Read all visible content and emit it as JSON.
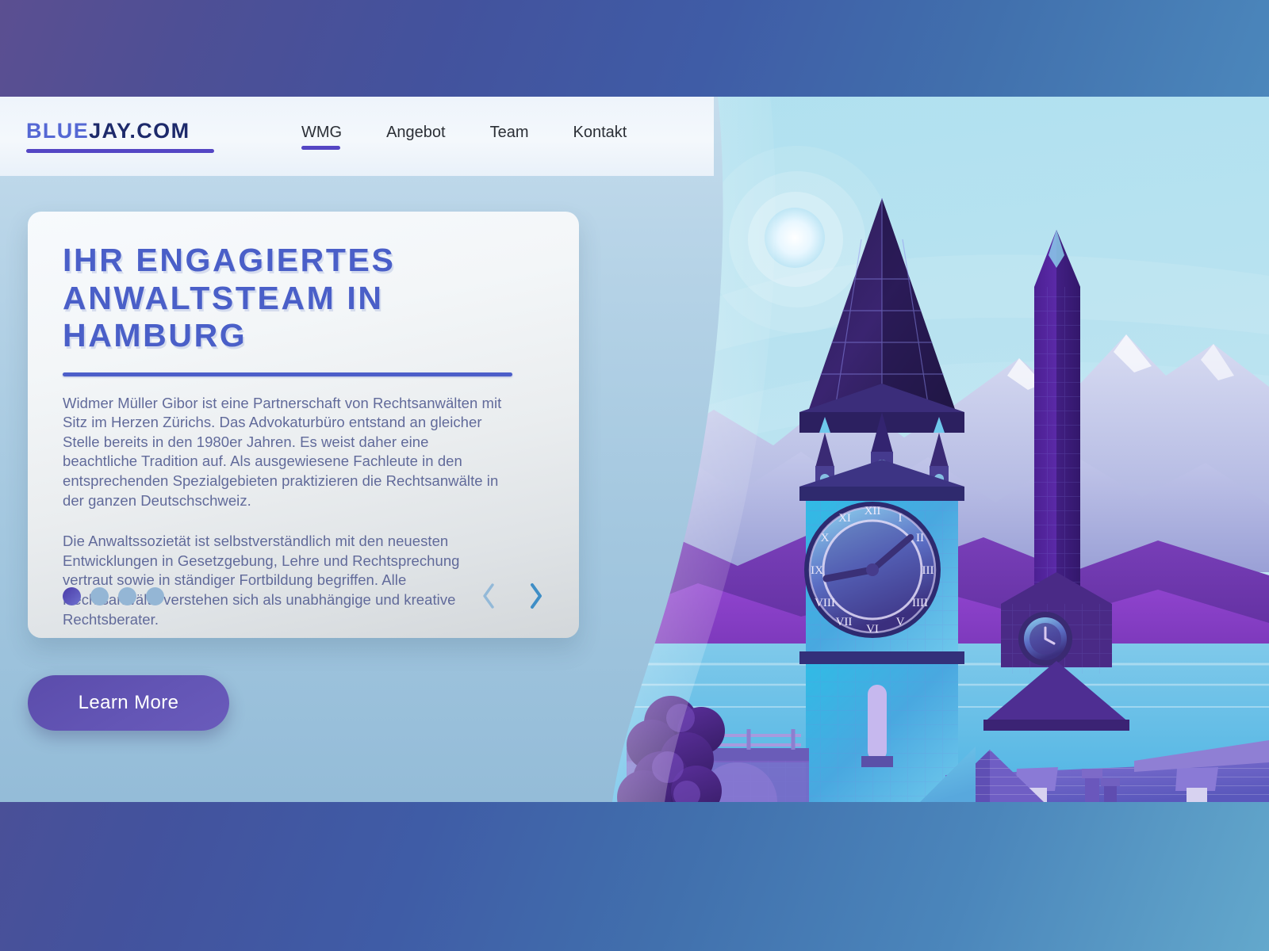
{
  "brand": {
    "logo_blue": "BLUE",
    "logo_dark": "JAY.COM",
    "accent_color": "#5446c4",
    "heading_color": "#4a5fc8",
    "body_text_color": "#616a9a",
    "button_color": "#6355b5"
  },
  "nav": {
    "items": [
      {
        "label": "WMG",
        "active": true
      },
      {
        "label": "Angebot",
        "active": false
      },
      {
        "label": "Team",
        "active": false
      },
      {
        "label": "Kontakt",
        "active": false
      }
    ]
  },
  "hero": {
    "heading_lines": [
      "IHR ENGAGIERTES",
      "ANWALTSTEAM IN",
      "HAMBURG"
    ],
    "paragraph_1": "Widmer Müller Gibor ist eine Partnerschaft von Rechtsanwälten mit Sitz im Herzen Zürichs. Das Advokaturbüro entstand an gleicher Stelle bereits in den 1980er Jahren. Es weist daher eine beachtliche Tradition auf. Als ausgewiesene Fachleute in den entsprechenden Spezialgebieten praktizieren die Rechtsanwälte in der ganzen Deutschschweiz.",
    "paragraph_2": "Die Anwaltssozietät ist selbstverständlich mit den neuesten Entwicklungen in Gesetzgebung, Lehre und Rechtsprechung vertraut sowie in ständiger Fortbildung begriffen. Alle Rechtsanwälte verstehen sich als unabhängige und kreative Rechtsberater.",
    "cta_label": "Learn More"
  },
  "carousel": {
    "total_slides": 4,
    "active_slide": 1,
    "prev_icon": "chevron-left-icon",
    "next_icon": "chevron-right-icon",
    "prev_color": "#93b9d8",
    "next_color": "#3f8ec6"
  },
  "illustration": {
    "description": "Low-poly night-blue city scene with two gothic clock towers, mountains, lake, bridge and rooftops",
    "sun_icon": "sun-glow",
    "clock_numerals": [
      "XII",
      "I",
      "II",
      "III",
      "IIII",
      "V",
      "VI",
      "VII",
      "VIII",
      "IX",
      "X",
      "XI"
    ]
  }
}
